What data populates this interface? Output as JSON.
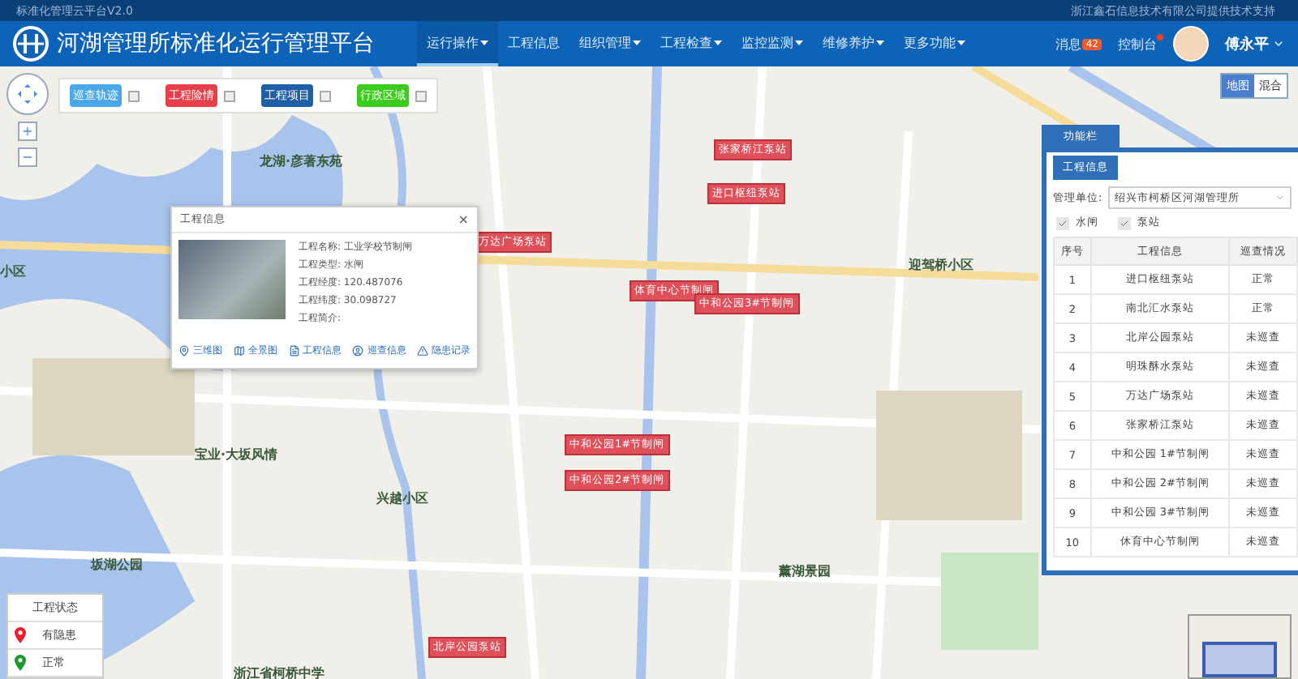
{
  "top_strip": {
    "left": "标准化管理云平台V2.0",
    "right": "浙江鑫石信息技术有限公司提供技术支持"
  },
  "header": {
    "title": "河湖管理所标准化运行管理平台",
    "nav": [
      {
        "label": "运行操作",
        "dropdown": true,
        "selected": true
      },
      {
        "label": "工程信息",
        "dropdown": false,
        "selected": false
      },
      {
        "label": "组织管理",
        "dropdown": true,
        "selected": false
      },
      {
        "label": "工程检查",
        "dropdown": true,
        "selected": false
      },
      {
        "label": "监控监测",
        "dropdown": true,
        "selected": false
      },
      {
        "label": "维修养护",
        "dropdown": true,
        "selected": false
      },
      {
        "label": "更多功能",
        "dropdown": true,
        "selected": false
      }
    ],
    "messages": {
      "label": "消息",
      "badge": "42"
    },
    "console": {
      "label": "控制台",
      "dot": true
    },
    "user": "傅永平"
  },
  "layers": [
    {
      "label": "巡查轨迹",
      "color": "#4aa8e8",
      "checked": false
    },
    {
      "label": "工程险情",
      "color": "#e8404a",
      "checked": false
    },
    {
      "label": "工程项目",
      "color": "#1e5fa8",
      "checked": false
    },
    {
      "label": "行政区域",
      "color": "#3ccc1e",
      "checked": false
    }
  ],
  "map_types": [
    {
      "label": "地图",
      "selected": true
    },
    {
      "label": "混合",
      "selected": false
    }
  ],
  "map_places": [
    "龙湖·彦著东苑",
    "迎驾桥小区",
    "兴越小区",
    "宝业·大坂风情",
    "坂湖公园",
    "薰湖景园",
    "浙江省柯桥中学",
    "小区"
  ],
  "stations": [
    "张家桥江泵站",
    "进口枢纽泵站",
    "体育中心节制闸",
    "中和公园3#节制闸",
    "万达广场泵站",
    "中和公园1#节制闸",
    "中和公园2#节制闸",
    "北岸公园泵站"
  ],
  "popup": {
    "title": "工程信息",
    "close": "×",
    "fields": [
      {
        "label": "工程名称:",
        "value": "工业学校节制闸"
      },
      {
        "label": "工程类型:",
        "value": "水闸"
      },
      {
        "label": "工程经度:",
        "value": "120.487076"
      },
      {
        "label": "工程纬度:",
        "value": "30.098727"
      },
      {
        "label": "工程简介:"
      }
    ],
    "actions": [
      {
        "kind": "pin",
        "label": "三维图"
      },
      {
        "kind": "map",
        "label": "全景图"
      },
      {
        "kind": "file",
        "label": "工程信息"
      },
      {
        "kind": "user",
        "label": "巡查信息"
      },
      {
        "kind": "alert",
        "label": "隐患记录"
      }
    ]
  },
  "panel": {
    "tab": "功能栏",
    "subtab": {
      "label": "工程信息",
      "selected": true
    },
    "unit_label": "管理单位:",
    "unit_value": "绍兴市柯桥区河湖管理所",
    "filters": [
      {
        "label": "水闸",
        "checked": true
      },
      {
        "label": "泵站",
        "checked": true
      }
    ],
    "columns": [
      "序号",
      "工程信息",
      "巡查情况"
    ],
    "rows": [
      [
        "1",
        "进口枢纽泵站",
        "正常"
      ],
      [
        "2",
        "南北汇水泵站",
        "正常"
      ],
      [
        "3",
        "北岸公园泵站",
        "未巡查"
      ],
      [
        "4",
        "明珠酥水泵站",
        "未巡查"
      ],
      [
        "5",
        "万达广场泵站",
        "未巡查"
      ],
      [
        "6",
        "张家桥江泵站",
        "未巡查"
      ],
      [
        "7",
        "中和公园 1#节制闸",
        "未巡查"
      ],
      [
        "8",
        "中和公园 2#节制闸",
        "未巡查"
      ],
      [
        "9",
        "中和公园 3#节制闸",
        "未巡查"
      ],
      [
        "10",
        "休育中心节制闸",
        "未巡查"
      ]
    ]
  },
  "legend": {
    "title": "工程状态",
    "items": [
      {
        "label": "有隐患",
        "color": "#e8202a"
      },
      {
        "label": "正常",
        "color": "#1a9a2a"
      }
    ]
  }
}
